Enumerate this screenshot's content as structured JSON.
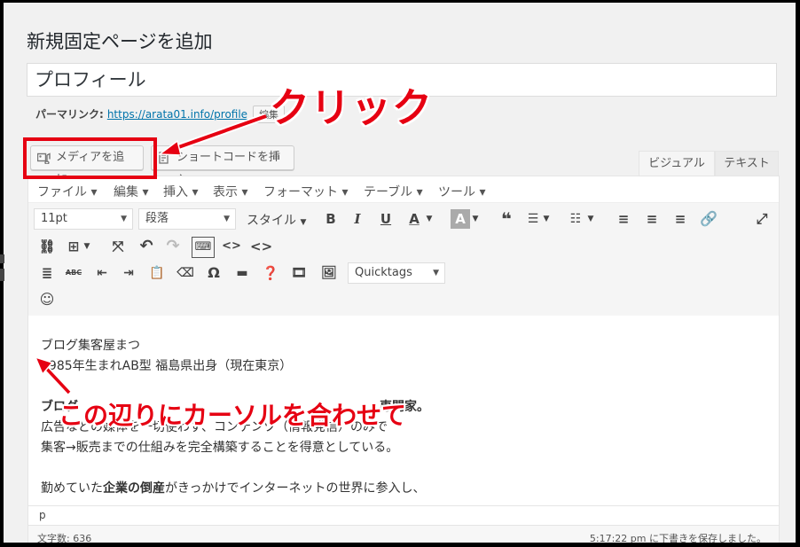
{
  "page_title": "新規固定ページを追加",
  "post_title": "プロフィール",
  "permalink": {
    "label": "パーマリンク:",
    "url": "https://arata01.info/profile",
    "edit_label": "編集"
  },
  "buttons": {
    "add_media": "メディアを追加",
    "insert_shortcode": "ショートコードを挿入"
  },
  "tabs": {
    "visual": "ビジュアル",
    "text": "テキスト"
  },
  "menubar": [
    "ファイル ▾",
    "編集 ▾",
    "挿入 ▾",
    "表示 ▾",
    "フォーマット ▾",
    "テーブル ▾",
    "ツール ▾"
  ],
  "toolbar": {
    "font_size": "11pt",
    "paragraph": "段落",
    "style": "スタイル",
    "quicktags": "Quicktags"
  },
  "content": {
    "line1": "ブログ集客屋まつ",
    "line2": "1985年生まれAB型 福島県出身（現在東京）",
    "line3_start": "ブログ",
    "line3_end": "専門家。",
    "line4": "広告などの媒体を一切使わず、コンテンツ（情報発信）のみで",
    "line5": "集客→販売までの仕組みを完全構築することを得意としている。",
    "line6_a": "勤めていた",
    "line6_b": "企業の倒産",
    "line6_c": "がきっかけでインターネットの世界に参入し、"
  },
  "status": {
    "path": "p",
    "word_count": "文字数: 636",
    "draft_saved": "5:17:22 pm に下書きを保存しました。"
  },
  "annotations": {
    "click": "クリック",
    "cursor": "この辺りにカーソルを合わせて"
  },
  "colors": {
    "annotation_red": "#e60012",
    "link_blue": "#0073aa"
  }
}
